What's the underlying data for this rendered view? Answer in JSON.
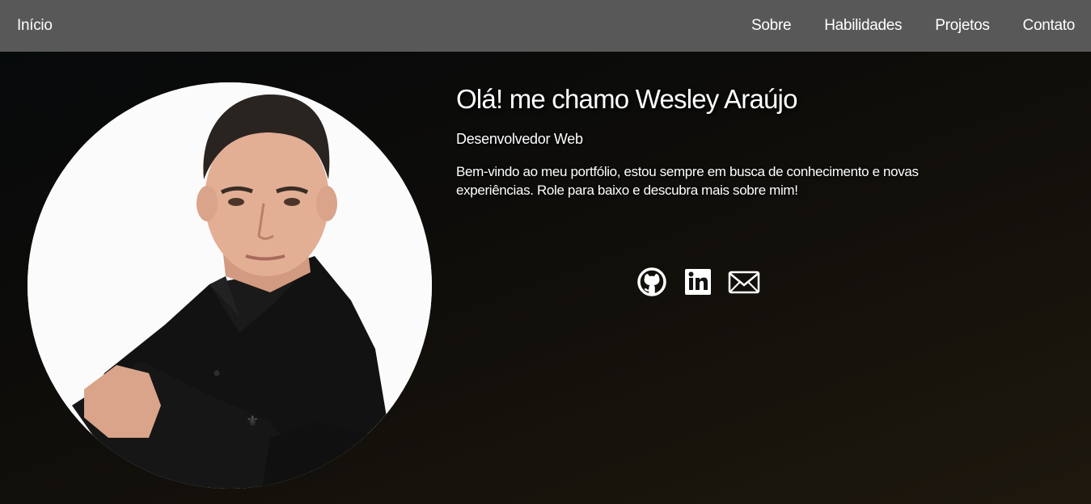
{
  "nav": {
    "home": "Início",
    "links": [
      "Sobre",
      "Habilidades",
      "Projetos",
      "Contato"
    ]
  },
  "hero": {
    "title": "Olá! me chamo Wesley Araújo",
    "subtitle": "Desenvolvedor Web",
    "description": "Bem-vindo ao meu portfólio, estou sempre em busca de conhecimento e novas experiências. Role para baixo e descubra mais sobre mim!"
  },
  "social": {
    "icons": [
      "github-icon",
      "linkedin-icon",
      "email-icon"
    ]
  },
  "colors": {
    "navbar": "#595858",
    "background": "#0d0c0a",
    "text": "#ffffff"
  }
}
